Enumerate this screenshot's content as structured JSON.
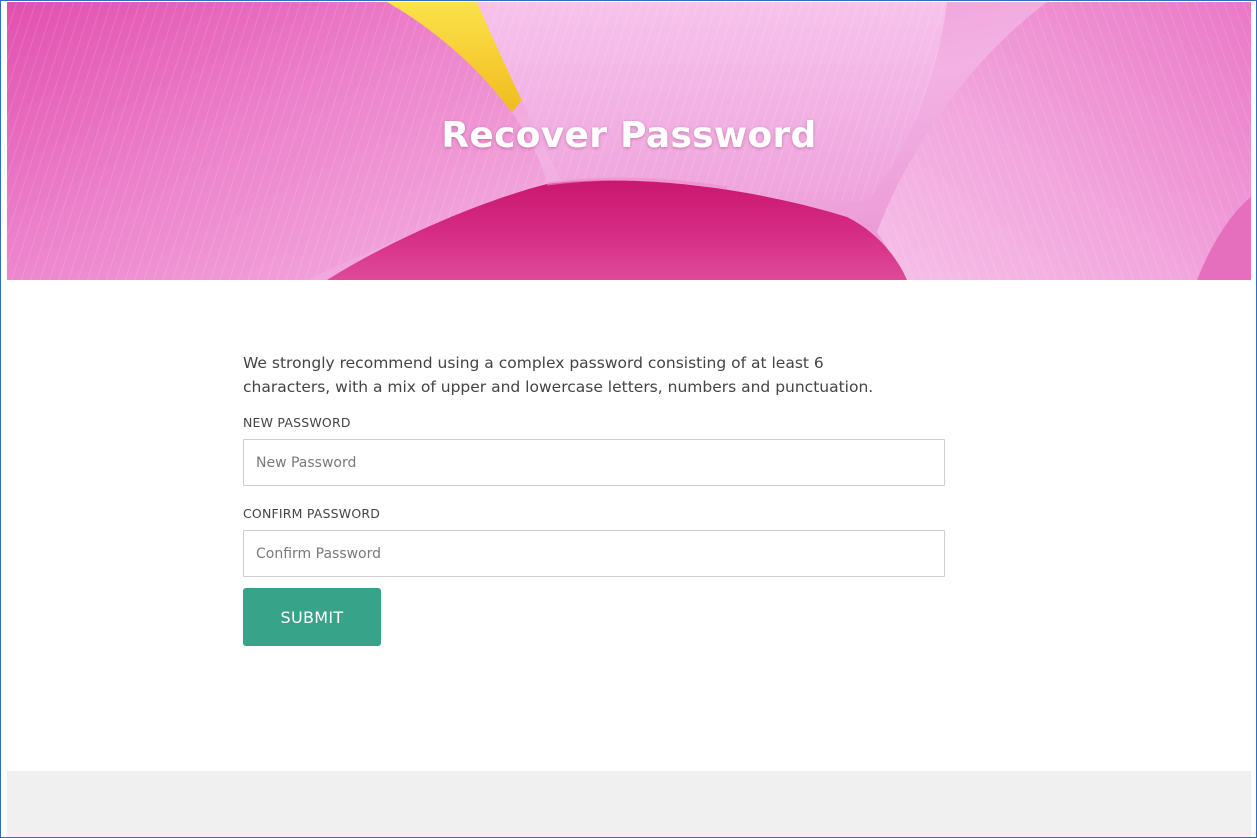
{
  "hero": {
    "title": "Recover Password",
    "colors": {
      "petal_light": "#f5b6e6",
      "petal_mid": "#e77cc8",
      "petal_deep": "#d0237a",
      "stamen": "#f5d02a"
    }
  },
  "form": {
    "intro_text": "We strongly recommend using a complex password consisting of at least 6 characters, with a mix of upper and lowercase letters, numbers and punctuation.",
    "new_password": {
      "label": "NEW PASSWORD",
      "placeholder": "New Password",
      "value": ""
    },
    "confirm_password": {
      "label": "CONFIRM PASSWORD",
      "placeholder": "Confirm Password",
      "value": ""
    },
    "submit_label": "SUBMIT",
    "accent_color": "#37a389"
  },
  "footer": {
    "background": "#f0f0f0"
  }
}
